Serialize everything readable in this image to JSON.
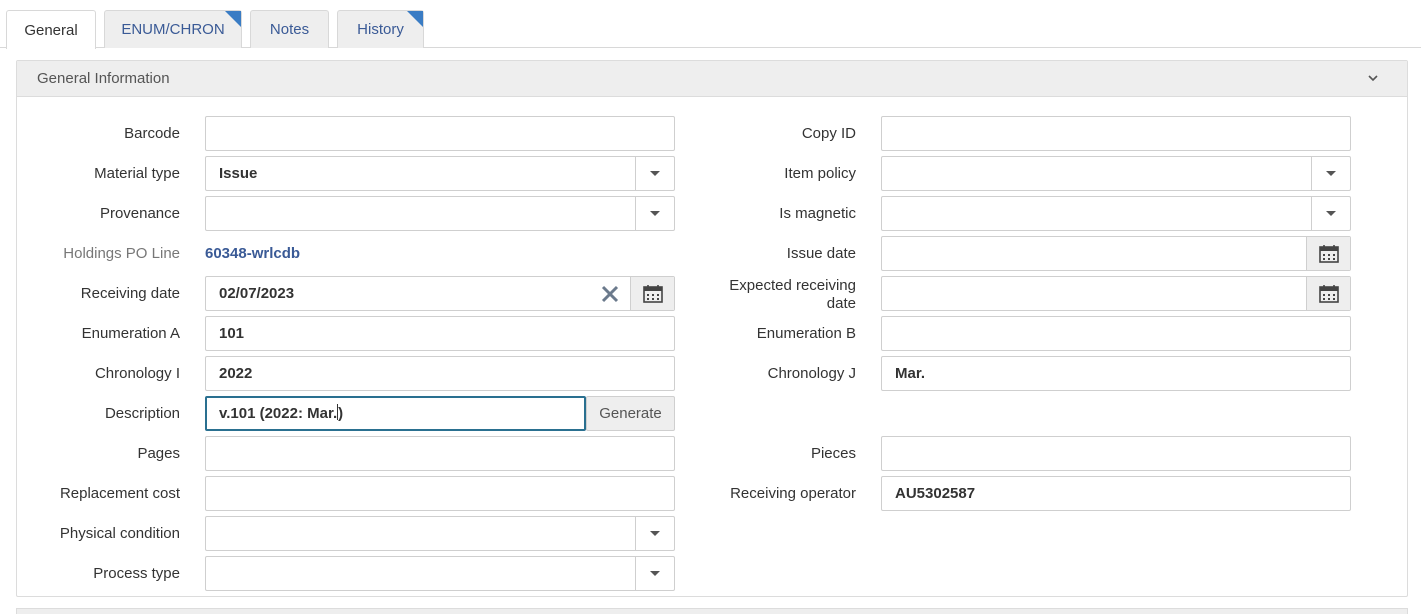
{
  "tabs": [
    {
      "label": "General"
    },
    {
      "label": "ENUM/CHRON"
    },
    {
      "label": "Notes"
    },
    {
      "label": "History"
    }
  ],
  "section": {
    "title": "General Information"
  },
  "left": {
    "barcode": {
      "label": "Barcode",
      "value": ""
    },
    "material_type": {
      "label": "Material type",
      "value": "Issue"
    },
    "provenance": {
      "label": "Provenance",
      "value": ""
    },
    "holdings_po_line": {
      "label": "Holdings PO Line",
      "value": "60348-wrlcdb"
    },
    "receiving_date": {
      "label": "Receiving date",
      "value": "02/07/2023"
    },
    "enumeration_a": {
      "label": "Enumeration A",
      "value": "101"
    },
    "chronology_i": {
      "label": "Chronology I",
      "value": "2022"
    },
    "description": {
      "label": "Description",
      "value": "v.101 (2022: Mar.",
      "value_tail": ")",
      "generate_label": "Generate"
    },
    "pages": {
      "label": "Pages",
      "value": ""
    },
    "replacement_cost": {
      "label": "Replacement cost",
      "value": ""
    },
    "physical_condition": {
      "label": "Physical condition",
      "value": ""
    },
    "process_type": {
      "label": "Process type",
      "value": ""
    }
  },
  "right": {
    "copy_id": {
      "label": "Copy ID",
      "value": ""
    },
    "item_policy": {
      "label": "Item policy",
      "value": ""
    },
    "is_magnetic": {
      "label": "Is magnetic",
      "value": ""
    },
    "issue_date": {
      "label": "Issue date",
      "value": ""
    },
    "expected_receiving_date": {
      "label_line1": "Expected receiving",
      "label_line2": "date",
      "value": ""
    },
    "enumeration_b": {
      "label": "Enumeration B",
      "value": ""
    },
    "chronology_j": {
      "label": "Chronology J",
      "value": "Mar."
    },
    "pieces": {
      "label": "Pieces",
      "value": ""
    },
    "receiving_operator": {
      "label": "Receiving operator",
      "value": "AU5302587"
    }
  },
  "icons": {
    "dropdown": "chevron-down-icon",
    "calendar": "calendar-icon",
    "clear": "close-icon",
    "tab_corner": "corner-flag-icon"
  },
  "colors": {
    "link": "#3a5a96",
    "tab_flag": "#3a7cc4",
    "focus": "#2a7090"
  }
}
